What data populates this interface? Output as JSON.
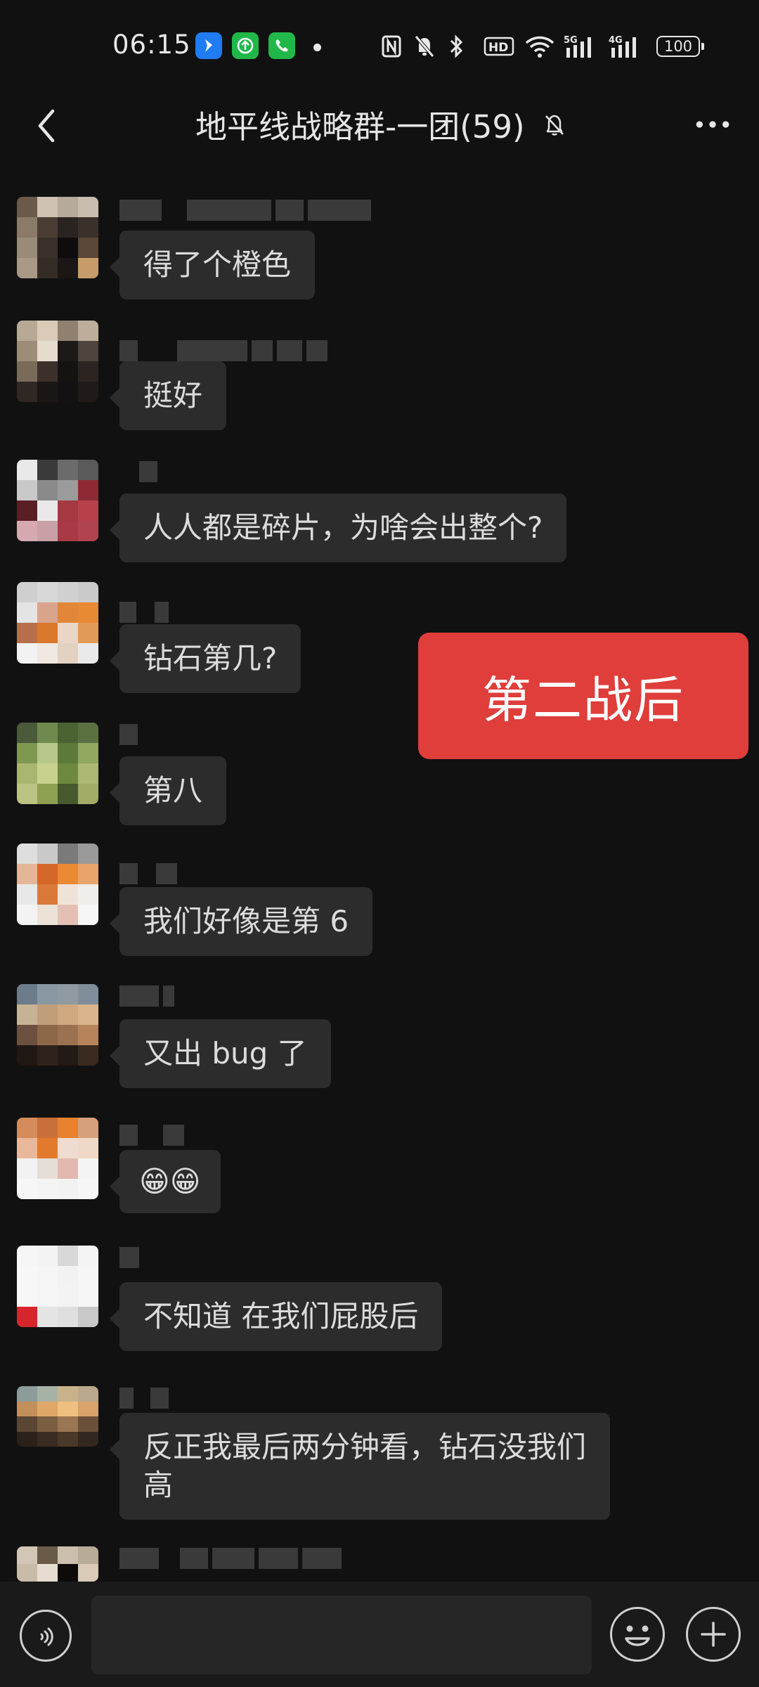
{
  "status_bar": {
    "time": "06:15",
    "network_labels": [
      "5G",
      "4G"
    ],
    "battery": "100",
    "hd_label": "HD"
  },
  "header": {
    "back_icon": "chevron-left-icon",
    "title": "地平线战略群-一团(59)",
    "mute_icon": "bell-off-icon",
    "more_icon": "more-dots-icon"
  },
  "messages": [
    {
      "text": "得了个橙色"
    },
    {
      "text": "挺好"
    },
    {
      "text": "人人都是碎片，为啥会出整个?"
    },
    {
      "text": "钻石第几?"
    },
    {
      "text": "第八"
    },
    {
      "text": "我们好像是第 6"
    },
    {
      "text": "又出 bug 了"
    },
    {
      "text": "😁😁"
    },
    {
      "text": "不知道 在我们屁股后"
    },
    {
      "text": "反正我最后两分钟看，钻石没我们\n高"
    }
  ],
  "overlay_tag": {
    "text": "第二战后",
    "color": "#df3e3b"
  },
  "input_bar": {
    "placeholder": "",
    "voice_icon": "voice-icon",
    "emoji_icon": "emoji-icon",
    "plus_icon": "plus-icon"
  }
}
